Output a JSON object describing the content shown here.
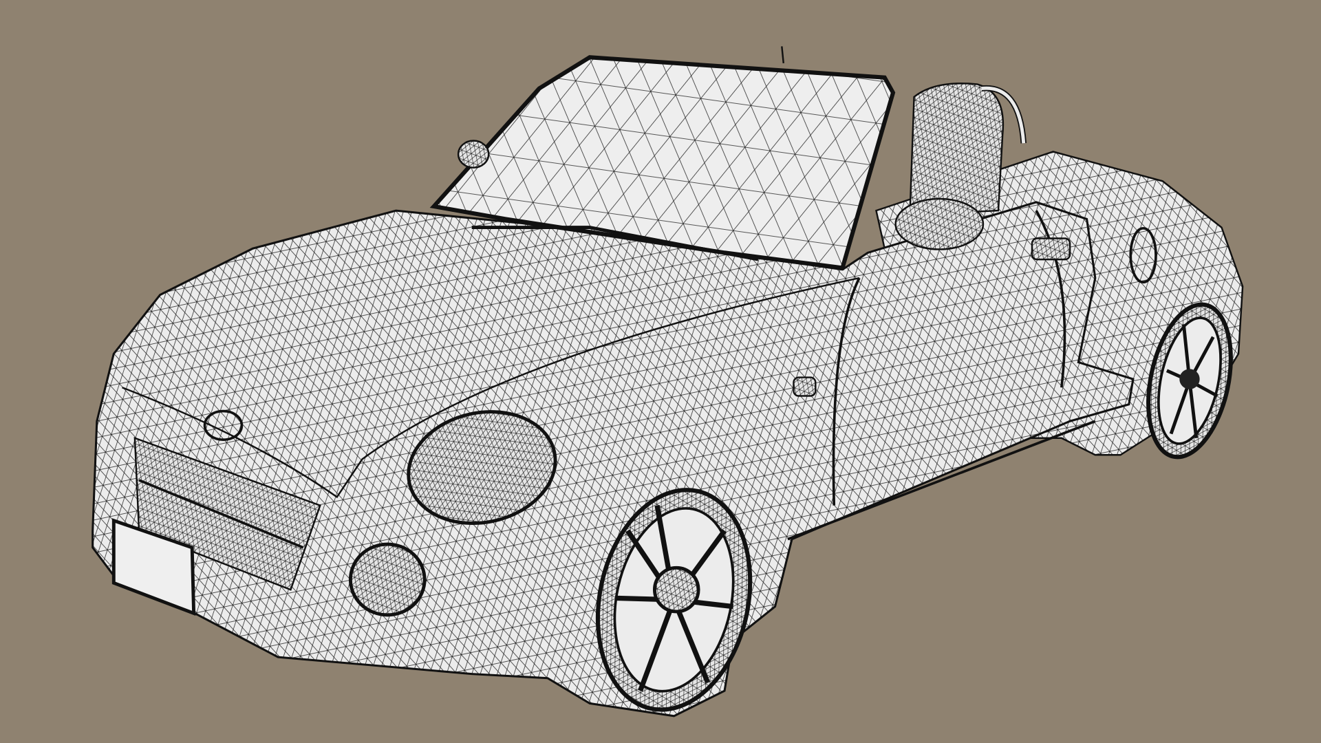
{
  "scene": {
    "subject": "wireframe-convertible-car",
    "colors": {
      "background": "#8f8270",
      "surface": "#ececec",
      "wire": "#1a1a1a"
    }
  }
}
